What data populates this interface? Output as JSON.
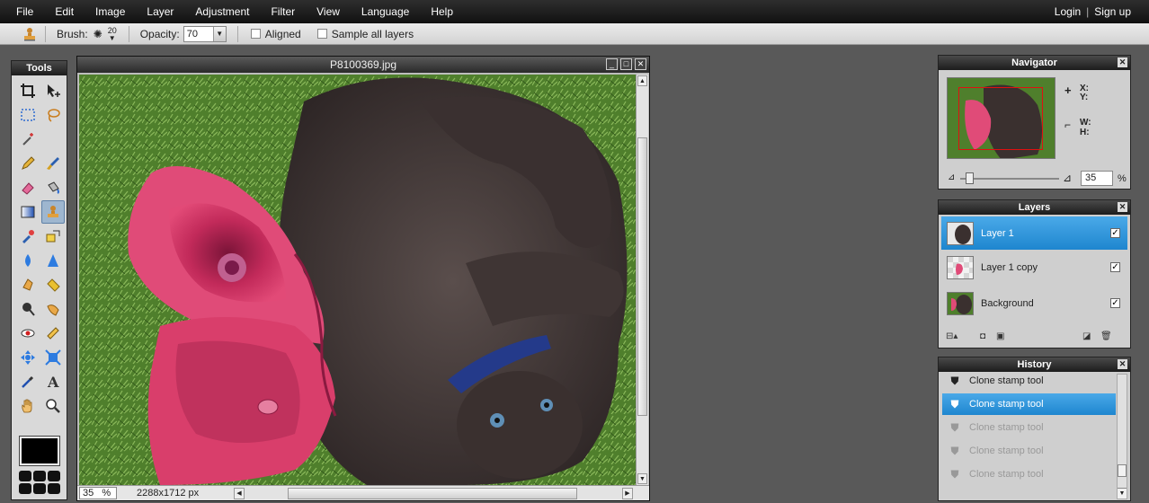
{
  "menu": {
    "items": [
      "File",
      "Edit",
      "Image",
      "Layer",
      "Adjustment",
      "Filter",
      "View",
      "Language",
      "Help"
    ],
    "login": "Login",
    "separator": "|",
    "signup": "Sign up"
  },
  "options": {
    "brush_label": "Brush:",
    "brush_size": "20",
    "opacity_label": "Opacity:",
    "opacity_value": "70",
    "aligned_label": "Aligned",
    "aligned_checked": false,
    "sample_label": "Sample all layers",
    "sample_checked": false
  },
  "tools": {
    "title": "Tools",
    "selected": "clone-stamp-tool",
    "foreground_color": "#000000"
  },
  "document": {
    "title": "P8100369.jpg",
    "zoom": "35",
    "zoom_unit": "%",
    "dimensions": "2288x1712 px"
  },
  "navigator": {
    "title": "Navigator",
    "x_label": "X:",
    "y_label": "Y:",
    "w_label": "W:",
    "h_label": "H:",
    "zoom": "35",
    "percent": "%"
  },
  "layers": {
    "title": "Layers",
    "items": [
      {
        "name": "Layer 1",
        "active": true,
        "visible": true
      },
      {
        "name": "Layer 1 copy",
        "active": false,
        "visible": true
      },
      {
        "name": "Background",
        "active": false,
        "visible": true
      }
    ]
  },
  "history": {
    "title": "History",
    "items": [
      {
        "label": "Clone stamp tool",
        "state": "past"
      },
      {
        "label": "Clone stamp tool",
        "state": "current"
      },
      {
        "label": "Clone stamp tool",
        "state": "future"
      },
      {
        "label": "Clone stamp tool",
        "state": "future"
      },
      {
        "label": "Clone stamp tool",
        "state": "future"
      }
    ]
  },
  "colors": {
    "accent": "#1e86cf",
    "menubar": "#1a1a1a",
    "workspace": "#595959"
  }
}
